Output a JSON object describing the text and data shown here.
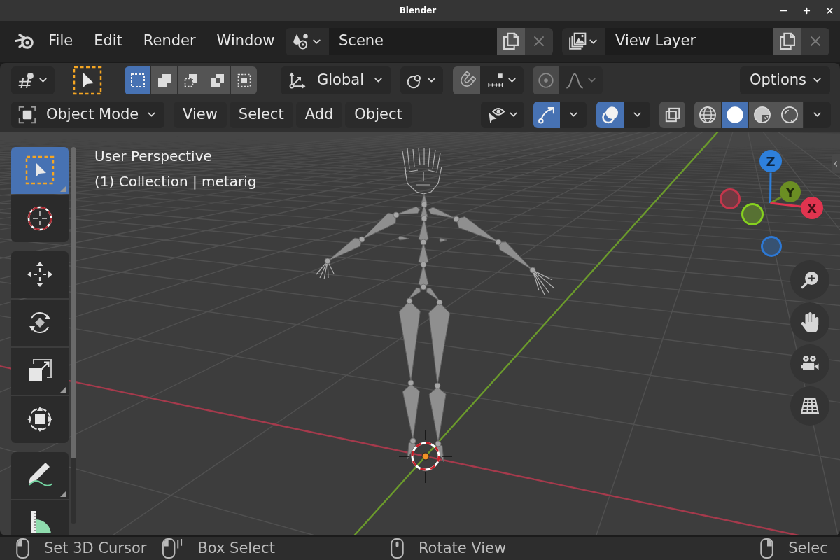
{
  "window": {
    "title": "Blender"
  },
  "menu_bar": {
    "items": [
      {
        "label": "File"
      },
      {
        "label": "Edit"
      },
      {
        "label": "Render"
      },
      {
        "label": "Window"
      }
    ]
  },
  "scene_selector": {
    "value": "Scene"
  },
  "view_layer_selector": {
    "value": "View Layer"
  },
  "tool_settings": {
    "selection_modes": [
      {
        "kind": "set",
        "selected": true
      },
      {
        "kind": "extend",
        "selected": false
      },
      {
        "kind": "subtract",
        "selected": false
      },
      {
        "kind": "difference",
        "selected": false
      },
      {
        "kind": "intersect",
        "selected": false
      }
    ],
    "orientation": "Global",
    "snapping": {
      "on": false
    },
    "proportional_editing": {
      "on": false
    },
    "options": "Options"
  },
  "header": {
    "mode": "Object Mode",
    "menus": [
      {
        "label": "View"
      },
      {
        "label": "Select"
      },
      {
        "label": "Add"
      },
      {
        "label": "Object"
      }
    ],
    "gizmos": {
      "on": true
    },
    "overlays": {
      "on": true
    },
    "xray": {
      "on": false
    },
    "shading_modes": [
      {
        "kind": "wireframe",
        "selected": false
      },
      {
        "kind": "solid",
        "selected": true
      },
      {
        "kind": "material",
        "selected": false
      },
      {
        "kind": "rendered",
        "selected": false
      }
    ]
  },
  "toolbar": {
    "groups": [
      {
        "tools": [
          {
            "kind": "select_box",
            "selected": true,
            "has_submenu": true
          },
          {
            "kind": "cursor",
            "selected": false,
            "has_submenu": false
          }
        ]
      },
      {
        "tools": [
          {
            "kind": "move",
            "selected": false,
            "has_submenu": false
          },
          {
            "kind": "rotate",
            "selected": false,
            "has_submenu": false
          },
          {
            "kind": "scale",
            "selected": false,
            "has_submenu": true
          },
          {
            "kind": "transform",
            "selected": false,
            "has_submenu": false
          }
        ]
      },
      {
        "tools": [
          {
            "kind": "annotate",
            "selected": false,
            "has_submenu": true
          },
          {
            "kind": "measure",
            "selected": false,
            "has_submenu": false
          }
        ]
      }
    ]
  },
  "viewport": {
    "overlay_lines": [
      "User Perspective",
      "(1) Collection | metarig"
    ],
    "navigation_gizmo": {
      "axes": [
        {
          "kind": "positive",
          "label": "Z",
          "color": "#2e80dc"
        },
        {
          "kind": "positive",
          "label": "Y",
          "color": "#6b8e23"
        },
        {
          "kind": "negative",
          "color": "#c5364c"
        },
        {
          "kind": "positive",
          "label": "X",
          "color": "#e0344f"
        },
        {
          "kind": "negative",
          "color": "#86d11f"
        },
        {
          "kind": "negative",
          "color": "#2d78d4"
        }
      ]
    }
  },
  "status_bar": {
    "items": [
      {
        "kind": "left",
        "label": "Set 3D Cursor"
      },
      {
        "kind": "left_drag",
        "label": "Box Select"
      },
      {
        "kind": "middle",
        "label": "Rotate View"
      },
      {
        "kind": "right",
        "label": "Selec"
      }
    ]
  }
}
